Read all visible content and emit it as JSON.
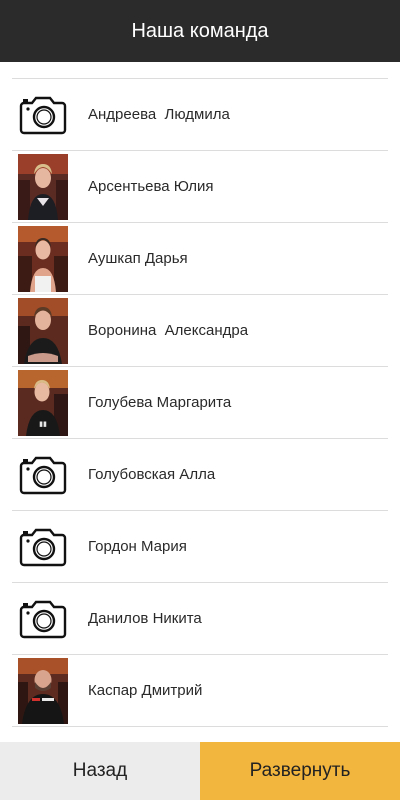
{
  "header": {
    "title": "Наша команда"
  },
  "members": [
    {
      "name": "Андреева  Людмила",
      "avatar": "camera-icon"
    },
    {
      "name": "Арсентьева Юлия",
      "avatar": "photo"
    },
    {
      "name": "Аушкап Дарья",
      "avatar": "photo"
    },
    {
      "name": "Воронина  Александра",
      "avatar": "photo"
    },
    {
      "name": "Голубева Маргарита",
      "avatar": "photo"
    },
    {
      "name": "Голубовская Алла",
      "avatar": "camera-icon"
    },
    {
      "name": "Гордон Мария",
      "avatar": "camera-icon"
    },
    {
      "name": "Данилов Никита",
      "avatar": "camera-icon"
    },
    {
      "name": "Каспар Дмитрий",
      "avatar": "photo"
    }
  ],
  "footer": {
    "back_label": "Назад",
    "expand_label": "Развернуть"
  },
  "colors": {
    "header_bg": "#2b2b2b",
    "accent": "#f2b53e",
    "back_bg": "#ececec"
  }
}
